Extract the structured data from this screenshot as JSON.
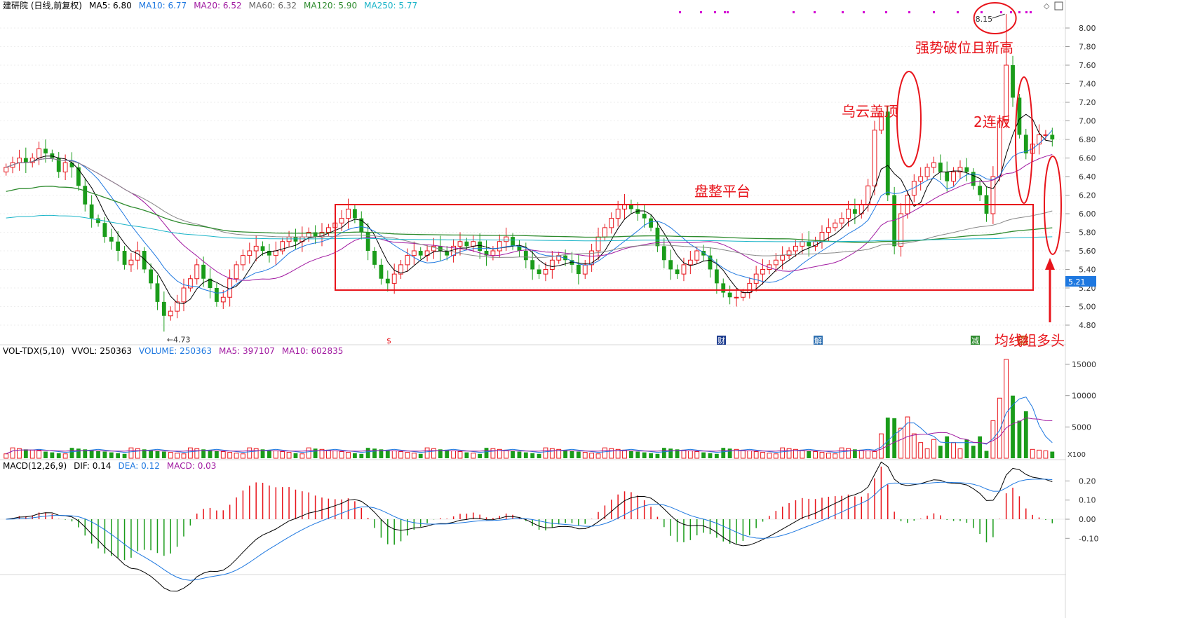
{
  "price_header": {
    "title": "建研院 (日线,前复权)",
    "ma5": "MA5: 6.80",
    "ma10": "MA10: 6.77",
    "ma20": "MA20: 6.52",
    "ma60": "MA60: 6.32",
    "ma120": "MA120: 5.90",
    "ma250": "MA250: 5.77"
  },
  "vol_header": {
    "title": "VOL-TDX(5,10)",
    "vvol": "VVOL: 250363",
    "volume": "VOLUME: 250363",
    "ma5": "MA5: 397107",
    "ma10": "MA10: 602835"
  },
  "macd_header": {
    "title": "MACD(12,26,9)",
    "dif": "DIF: 0.14",
    "dea": "DEA: 0.12",
    "macd": "MACD: 0.03"
  },
  "annotations": {
    "breakout": "强势破位且新高",
    "dark_cloud": "乌云盖顶",
    "limit_up": "2连板",
    "platform": "盘整平台",
    "bull_ma": "均线组多头"
  },
  "markers": {
    "high": "8.15",
    "low": "4.73",
    "current_price": "5.21",
    "vol_unit": "X100"
  },
  "event_tags": [
    "$",
    "财",
    "解",
    "减",
    "榜"
  ],
  "colors": {
    "up": "#e8141b",
    "down": "#1a9c1a",
    "ma5": "#000000",
    "ma10": "#1e78e0",
    "ma20": "#a11aa1",
    "ma60": "#888888",
    "ma120": "#2e8b2e",
    "ma250": "#1ab4c8",
    "annotation": "#e8141b"
  },
  "chart_data": [
    {
      "type": "candlestick",
      "title": "建研院 (日线,前复权)",
      "y_axis_ticks": [
        "8.00",
        "7.80",
        "7.60",
        "7.40",
        "7.20",
        "7.00",
        "6.80",
        "6.60",
        "6.40",
        "6.20",
        "6.00",
        "5.80",
        "5.60",
        "5.40",
        "5.20",
        "5.00",
        "4.80"
      ],
      "ylim": [
        4.66,
        8.22
      ],
      "closes": [
        6.5,
        6.55,
        6.6,
        6.55,
        6.6,
        6.7,
        6.65,
        6.6,
        6.45,
        6.55,
        6.5,
        6.3,
        6.1,
        5.95,
        5.9,
        5.75,
        5.7,
        5.6,
        5.45,
        5.5,
        5.6,
        5.4,
        5.25,
        5.05,
        4.9,
        4.95,
        5.05,
        5.2,
        5.3,
        5.45,
        5.3,
        5.2,
        5.05,
        5.1,
        5.3,
        5.45,
        5.55,
        5.6,
        5.65,
        5.6,
        5.55,
        5.6,
        5.7,
        5.75,
        5.7,
        5.75,
        5.8,
        5.75,
        5.8,
        5.85,
        5.9,
        5.95,
        6.05,
        5.95,
        5.8,
        5.6,
        5.45,
        5.3,
        5.25,
        5.35,
        5.45,
        5.55,
        5.6,
        5.55,
        5.6,
        5.65,
        5.6,
        5.55,
        5.65,
        5.7,
        5.65,
        5.7,
        5.6,
        5.55,
        5.6,
        5.7,
        5.75,
        5.65,
        5.6,
        5.5,
        5.4,
        5.35,
        5.4,
        5.5,
        5.55,
        5.5,
        5.45,
        5.35,
        5.45,
        5.6,
        5.75,
        5.85,
        5.95,
        6.05,
        6.1,
        6.05,
        6.0,
        5.95,
        5.85,
        5.65,
        5.5,
        5.4,
        5.35,
        5.45,
        5.5,
        5.6,
        5.55,
        5.4,
        5.25,
        5.15,
        5.1,
        5.1,
        5.15,
        5.25,
        5.35,
        5.4,
        5.45,
        5.5,
        5.55,
        5.6,
        5.65,
        5.7,
        5.65,
        5.7,
        5.8,
        5.85,
        5.9,
        5.95,
        6.05,
        6.0,
        6.1,
        6.3,
        6.9,
        7.1,
        6.2,
        5.65,
        6.0,
        6.2,
        6.35,
        6.4,
        6.5,
        6.55,
        6.45,
        6.35,
        6.45,
        6.5,
        6.45,
        6.3,
        6.2,
        6.0,
        6.4,
        7.0,
        7.6,
        7.25,
        6.85,
        6.65,
        6.75,
        6.85,
        6.85,
        6.8
      ],
      "volume_y_ticks": [
        "15000",
        "10000",
        "5000"
      ],
      "volume_unit": "X100",
      "volume_shape": "low and flat through the consolidation, sharp spikes near the right edge with the peak near 15000",
      "macd_y_ticks": [
        "0.20",
        "0.10",
        "0.00",
        "-0.10"
      ],
      "last_values": {
        "DIF": 0.14,
        "DEA": 0.12,
        "MACD": 0.03
      },
      "annotations": [
        "强势破位且新高",
        "乌云盖顶",
        "2连板",
        "盘整平台",
        "均线组多头"
      ],
      "high_marker": "8.15",
      "low_marker": "4.73",
      "current_price": "5.21"
    }
  ]
}
